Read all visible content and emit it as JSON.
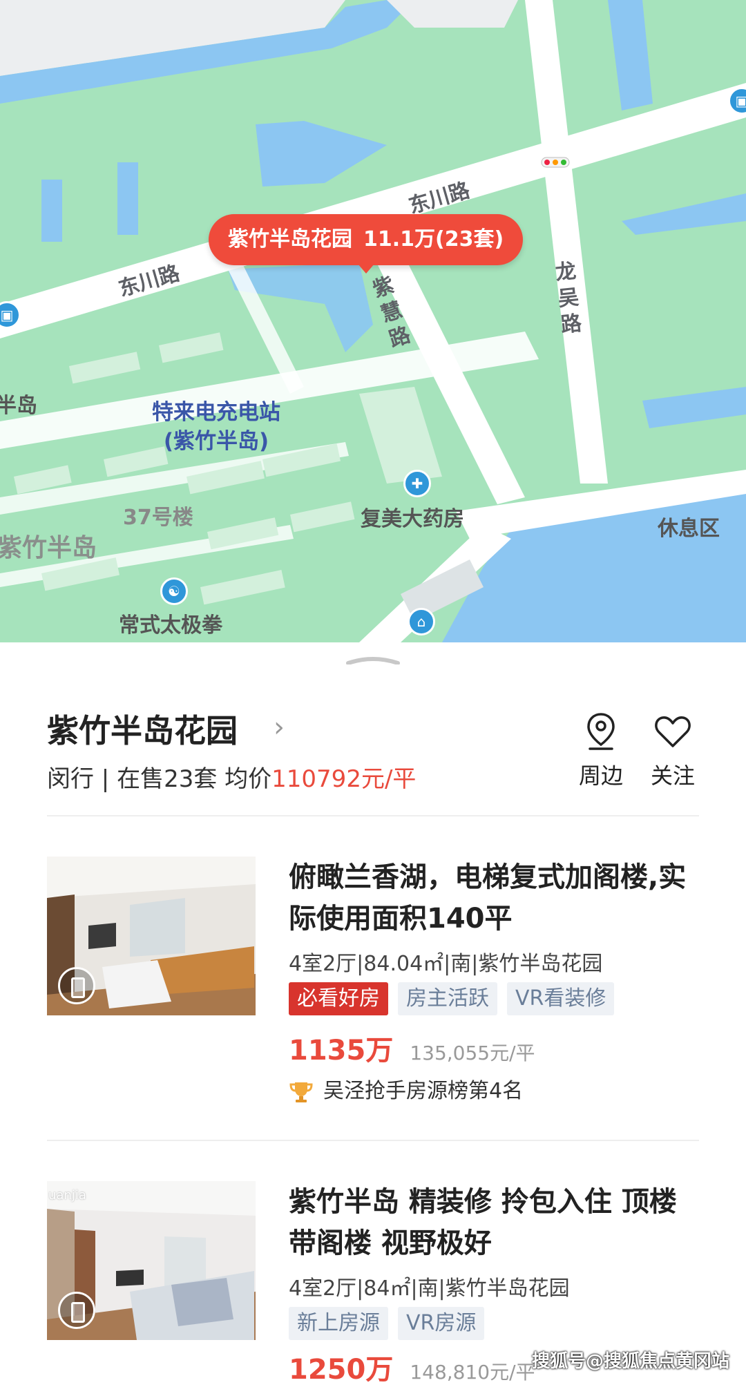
{
  "map": {
    "bubble": {
      "name": "紫竹半岛花园",
      "summary": "11.1万(23套)"
    },
    "road_labels": [
      "东川路",
      "东川路",
      "紫慧路",
      "龙吴路"
    ],
    "poi_labels": {
      "charger": "特来电充电站\n(紫竹半岛)",
      "pharmacy": "复美大药房",
      "building37": "37号楼",
      "district": "紫竹半岛",
      "taichi": "常式太极拳",
      "rest_area": "休息区",
      "edge_label": "半岛"
    },
    "colors": {
      "land": "#a6e3bc",
      "road": "#ffffff",
      "water": "#8cc6f2",
      "building": "#c7ecd2",
      "bubble": "#ef4b3b"
    }
  },
  "community": {
    "name": "紫竹半岛花园",
    "meta_prefix": "闵行 | 在售23套 均价",
    "avg_price": "110792元/平",
    "actions": {
      "nearby": "周边",
      "follow": "关注"
    }
  },
  "listings": [
    {
      "title": "俯瞰兰香湖，电梯复式加阁楼,实际使用面积140平",
      "spec": "4室2厅|84.04㎡|南|紫竹半岛花园",
      "tags": [
        {
          "label": "必看好房",
          "style": "hot"
        },
        {
          "label": "房主活跃",
          "style": "normal"
        },
        {
          "label": "VR看装修",
          "style": "normal"
        }
      ],
      "price": "1135万",
      "unit_price": "135,055元/平",
      "rank": "吴泾抢手房源榜第4名"
    },
    {
      "title": "紫竹半岛 精装修 拎包入住 顶楼带阁楼 视野极好",
      "spec": "4室2厅|84㎡|南|紫竹半岛花园",
      "tags": [
        {
          "label": "新上房源",
          "style": "normal"
        },
        {
          "label": "VR房源",
          "style": "normal"
        }
      ],
      "price": "1250万",
      "unit_price": "148,810元/平",
      "thumb_watermark": "uanjia"
    }
  ],
  "watermark": "搜狐号@搜狐焦点黄冈站",
  "icons": [
    "location-pin-icon",
    "heart-icon",
    "chevron-right-icon",
    "trophy-icon",
    "vr-icon",
    "bus-stop-icon",
    "pharmacy-icon",
    "taichi-icon",
    "building-icon",
    "traffic-light-icon"
  ]
}
